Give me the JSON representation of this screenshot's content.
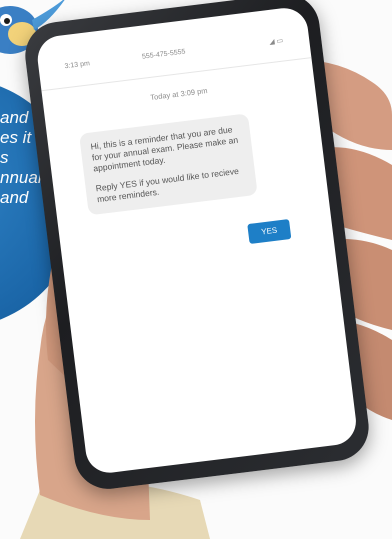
{
  "panel": {
    "lines": [
      "and",
      "es it",
      "s",
      "nnual",
      "and"
    ]
  },
  "phone": {
    "status_time": "3:13 pm",
    "status_number": "555-475-5555",
    "status_icons": "◢ ▭",
    "date_label": "Today at 3:09 pm",
    "message_paragraph_1": "Hi, this is a reminder that you are due for your annual exam. Please make an appointment today.",
    "message_paragraph_2": "Reply YES if you would like to recieve more reminders.",
    "reply_button": "YES"
  },
  "colors": {
    "panel_blue": "#1b66a8",
    "button_blue": "#1e7fc7",
    "bubble_gray": "#eeeeee"
  },
  "icons": [
    "bird-mascot-icon",
    "signal-icon",
    "battery-icon"
  ]
}
